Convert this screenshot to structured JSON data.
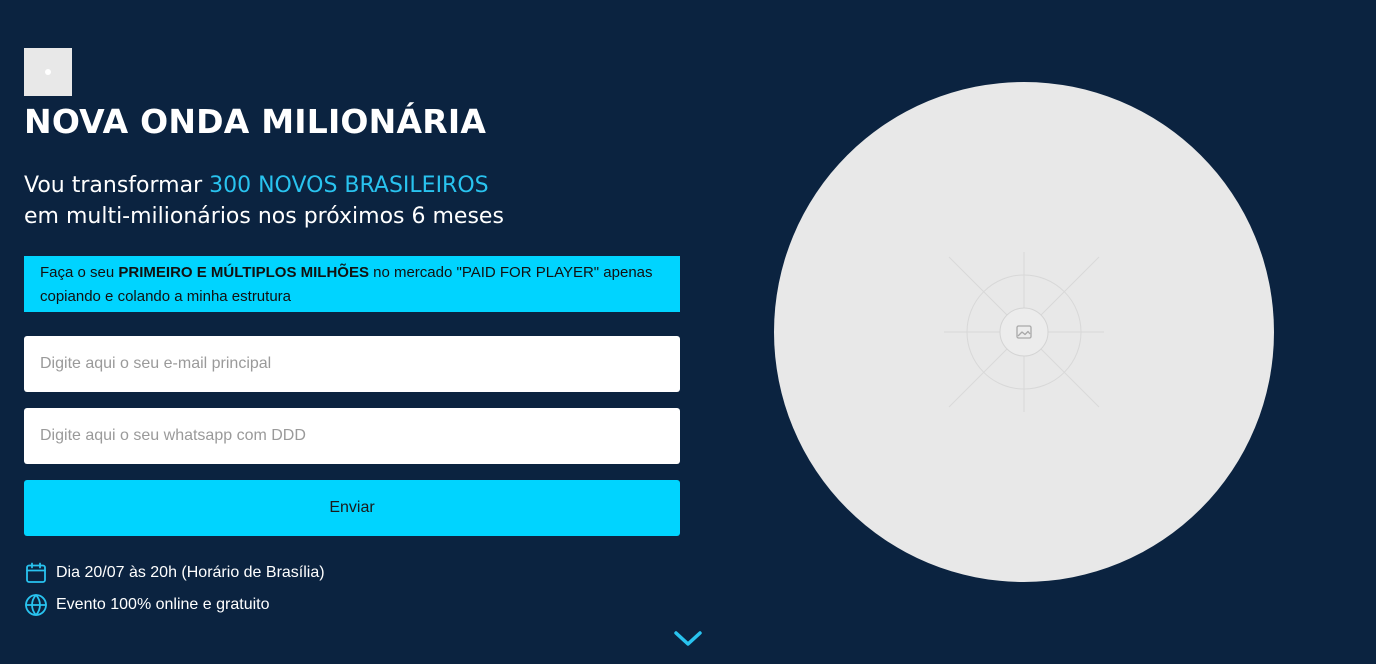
{
  "header": {
    "title": "NOVA ONDA MILIONÁRIA",
    "subtitle_prefix": "Vou transformar ",
    "subtitle_highlight": "300 NOVOS BRASILEIROS",
    "subtitle_line2": "em multi-milionários nos próximos 6 meses"
  },
  "banner": {
    "text_before": "Faça o seu ",
    "text_bold": "PRIMEIRO E MÚLTIPLOS MILHÕES",
    "text_after": " no mercado \"PAID FOR PLAYER\" apenas copiando e colando a minha estrutura"
  },
  "form": {
    "email_placeholder": "Digite aqui o seu e-mail principal",
    "email_value": "",
    "whatsapp_placeholder": "Digite aqui o seu whatsapp com DDD",
    "whatsapp_value": "",
    "submit_label": "Enviar"
  },
  "info": {
    "date_text": "Dia 20/07 às 20h (Horário de Brasília)",
    "online_text": "Evento 100% online e gratuito"
  },
  "icons": {
    "date": "calendar-icon",
    "online": "globe-icon",
    "scroll": "chevron-down-icon",
    "hero": "image-placeholder-icon"
  },
  "colors": {
    "background": "#0b2340",
    "accent": "#00d4ff",
    "highlight_text": "#29c3ef",
    "placeholder_gray": "#e8e8e8"
  }
}
